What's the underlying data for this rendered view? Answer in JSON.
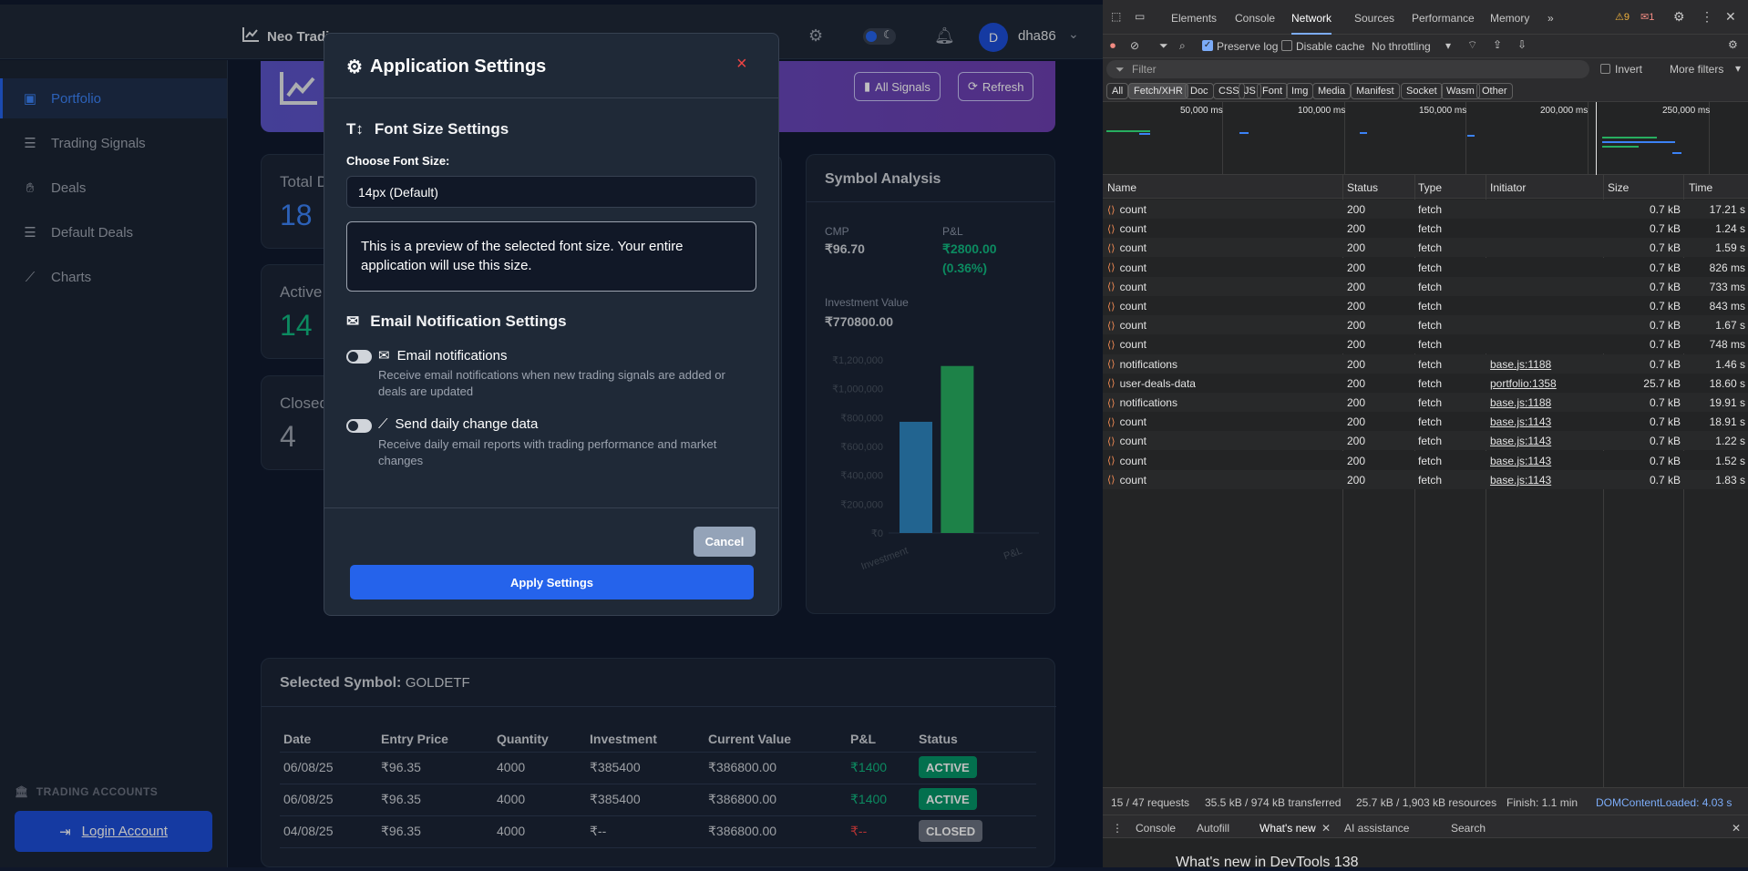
{
  "app": {
    "brand": "Neo Trading",
    "username": "dha86",
    "avatar_letter": "D"
  },
  "sidebar": {
    "items": [
      {
        "label": "Portfolio",
        "icon": "briefcase-icon"
      },
      {
        "label": "Trading Signals",
        "icon": "list-icon"
      },
      {
        "label": "Deals",
        "icon": "handshake-icon"
      },
      {
        "label": "Default Deals",
        "icon": "list-check-icon"
      },
      {
        "label": "Charts",
        "icon": "chart-line-icon"
      }
    ],
    "accounts_label": "TRADING ACCOUNTS",
    "login_label": "Login Account"
  },
  "hero": {
    "all_signals": "All Signals",
    "refresh": "Refresh"
  },
  "stats": [
    {
      "label": "Total D",
      "value": "18",
      "color": "#3b82f6"
    },
    {
      "label": "Active",
      "value": "14",
      "color": "#10b981"
    },
    {
      "label": "Closed",
      "value": "4",
      "color": "#9ca3af"
    }
  ],
  "symbol_analysis": {
    "title": "Symbol Analysis",
    "cmp_label": "CMP",
    "cmp_value": "₹96.70",
    "pl_label": "P&L",
    "pl_value": "₹2800.00",
    "pl_pct": "(0.36%)",
    "investment_label": "Investment Value",
    "investment_value": "₹770800.00"
  },
  "chart_data": {
    "type": "bar",
    "categories": [
      "Investment",
      "P&L"
    ],
    "values": [
      770800,
      1157600
    ],
    "colors": [
      "#2e86c1",
      "#27ae60"
    ],
    "yticks": [
      "₹0",
      "₹200,000",
      "₹400,000",
      "₹600,000",
      "₹800,000",
      "₹1,000,000",
      "₹1,200,000"
    ],
    "ylim": [
      0,
      1200000
    ]
  },
  "selected": {
    "label": "Selected Symbol:",
    "symbol": "GOLDETF",
    "headers": [
      "Date",
      "Entry Price",
      "Quantity",
      "Investment",
      "Current Value",
      "P&L",
      "Status"
    ],
    "rows": [
      {
        "date": "06/08/25",
        "entry": "₹96.35",
        "qty": "4000",
        "investment": "₹385400",
        "current": "₹386800.00",
        "pl": "₹1400",
        "status": "ACTIVE"
      },
      {
        "date": "06/08/25",
        "entry": "₹96.35",
        "qty": "4000",
        "investment": "₹385400",
        "current": "₹386800.00",
        "pl": "₹1400",
        "status": "ACTIVE"
      },
      {
        "date": "04/08/25",
        "entry": "₹96.35",
        "qty": "4000",
        "investment": "₹--",
        "current": "₹386800.00",
        "pl": "₹--",
        "status": "CLOSED"
      }
    ]
  },
  "modal": {
    "title": "Application Settings",
    "close": "×",
    "font_section": "Font Size Settings",
    "font_label": "Choose Font Size:",
    "font_value": "14px (Default)",
    "preview_text": "This is a preview of the selected font size. Your entire application will use this size.",
    "email_section": "Email Notification Settings",
    "opt1_label": "Email notifications",
    "opt1_desc": "Receive email notifications when new trading signals are added or deals are updated",
    "opt2_label": "Send daily change data",
    "opt2_desc": "Receive daily email reports with trading performance and market changes",
    "cancel": "Cancel",
    "apply": "Apply Settings"
  },
  "devtools": {
    "tabs": [
      "Elements",
      "Console",
      "Network",
      "Sources",
      "Performance",
      "Memory"
    ],
    "warnings": "9",
    "errors": "1",
    "preserve_log": "Preserve log",
    "disable_cache": "Disable cache",
    "throttling": "No throttling",
    "filter_placeholder": "Filter",
    "invert": "Invert",
    "more_filters": "More filters",
    "chips": [
      "All",
      "Fetch/XHR",
      "Doc",
      "CSS",
      "JS",
      "Font",
      "Img",
      "Media",
      "Manifest",
      "Socket",
      "Wasm",
      "Other"
    ],
    "timeline_ticks": [
      "50,000 ms",
      "100,000 ms",
      "150,000 ms",
      "200,000 ms",
      "250,000 ms"
    ],
    "columns": [
      "Name",
      "Status",
      "Type",
      "Initiator",
      "Size",
      "Time"
    ],
    "rows": [
      {
        "name": "count",
        "status": "200",
        "type": "fetch",
        "initiator": "",
        "size": "0.7 kB",
        "time": "17.21 s"
      },
      {
        "name": "count",
        "status": "200",
        "type": "fetch",
        "initiator": "",
        "size": "0.7 kB",
        "time": "1.24 s"
      },
      {
        "name": "count",
        "status": "200",
        "type": "fetch",
        "initiator": "",
        "size": "0.7 kB",
        "time": "1.59 s"
      },
      {
        "name": "count",
        "status": "200",
        "type": "fetch",
        "initiator": "",
        "size": "0.7 kB",
        "time": "826 ms"
      },
      {
        "name": "count",
        "status": "200",
        "type": "fetch",
        "initiator": "",
        "size": "0.7 kB",
        "time": "733 ms"
      },
      {
        "name": "count",
        "status": "200",
        "type": "fetch",
        "initiator": "",
        "size": "0.7 kB",
        "time": "843 ms"
      },
      {
        "name": "count",
        "status": "200",
        "type": "fetch",
        "initiator": "",
        "size": "0.7 kB",
        "time": "1.67 s"
      },
      {
        "name": "count",
        "status": "200",
        "type": "fetch",
        "initiator": "",
        "size": "0.7 kB",
        "time": "748 ms"
      },
      {
        "name": "notifications",
        "status": "200",
        "type": "fetch",
        "initiator": "base.js:1188",
        "size": "0.7 kB",
        "time": "1.46 s"
      },
      {
        "name": "user-deals-data",
        "status": "200",
        "type": "fetch",
        "initiator": "portfolio:1358",
        "size": "25.7 kB",
        "time": "18.60 s"
      },
      {
        "name": "notifications",
        "status": "200",
        "type": "fetch",
        "initiator": "base.js:1188",
        "size": "0.7 kB",
        "time": "19.91 s"
      },
      {
        "name": "count",
        "status": "200",
        "type": "fetch",
        "initiator": "base.js:1143",
        "size": "0.7 kB",
        "time": "18.91 s"
      },
      {
        "name": "count",
        "status": "200",
        "type": "fetch",
        "initiator": "base.js:1143",
        "size": "0.7 kB",
        "time": "1.22 s"
      },
      {
        "name": "count",
        "status": "200",
        "type": "fetch",
        "initiator": "base.js:1143",
        "size": "0.7 kB",
        "time": "1.52 s"
      },
      {
        "name": "count",
        "status": "200",
        "type": "fetch",
        "initiator": "base.js:1143",
        "size": "0.7 kB",
        "time": "1.83 s"
      }
    ],
    "status_bar": {
      "requests": "15 / 47 requests",
      "transferred": "35.5 kB / 974 kB transferred",
      "resources": "25.7 kB / 1,903 kB resources",
      "finish": "Finish: 1.1 min",
      "dcl": "DOMContentLoaded: 4.03 s"
    },
    "drawer_tabs": [
      "Console",
      "Autofill",
      "What's new",
      "AI assistance",
      "Search"
    ],
    "whats_new_text": "What's new in DevTools 138"
  }
}
